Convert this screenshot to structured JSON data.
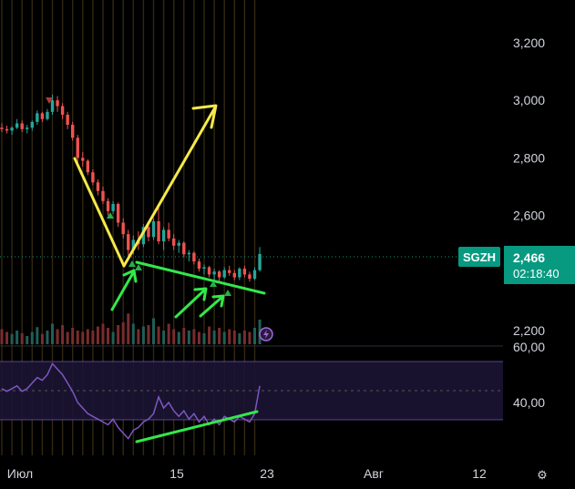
{
  "ticker": "SGZH",
  "last_price": "2,466",
  "countdown": "02:18:40",
  "colors": {
    "up": "#26a69a",
    "down": "#ef5350",
    "rsi": "#7e57c2",
    "annot_yellow": "#f5e94a",
    "annot_green": "#33e84a",
    "accent": "#089981"
  },
  "icons": {
    "settings": "gear-icon",
    "alert": "lightning-icon"
  },
  "chart_data": [
    {
      "type": "candlestick",
      "price_axis_labels": [
        "3,200",
        "3,000",
        "2,800",
        "2,600",
        "2,200"
      ],
      "ylim": [
        2140,
        3360
      ],
      "date_axis_labels": [
        "Июл",
        "15",
        "23",
        "Авг",
        "12"
      ],
      "current_price": 2466,
      "candles": [
        {
          "o": 2905,
          "h": 2920,
          "l": 2890,
          "c": 2900
        },
        {
          "o": 2900,
          "h": 2912,
          "l": 2885,
          "c": 2895
        },
        {
          "o": 2895,
          "h": 2910,
          "l": 2880,
          "c": 2905
        },
        {
          "o": 2905,
          "h": 2935,
          "l": 2900,
          "c": 2920
        },
        {
          "o": 2920,
          "h": 2930,
          "l": 2890,
          "c": 2900
        },
        {
          "o": 2900,
          "h": 2915,
          "l": 2885,
          "c": 2905
        },
        {
          "o": 2905,
          "h": 2930,
          "l": 2895,
          "c": 2925
        },
        {
          "o": 2925,
          "h": 2965,
          "l": 2915,
          "c": 2955
        },
        {
          "o": 2955,
          "h": 2960,
          "l": 2925,
          "c": 2935
        },
        {
          "o": 2935,
          "h": 2970,
          "l": 2930,
          "c": 2960
        },
        {
          "o": 2960,
          "h": 3020,
          "l": 2950,
          "c": 3000
        },
        {
          "o": 3000,
          "h": 3015,
          "l": 2960,
          "c": 2980
        },
        {
          "o": 2980,
          "h": 2990,
          "l": 2935,
          "c": 2950
        },
        {
          "o": 2950,
          "h": 2960,
          "l": 2900,
          "c": 2915
        },
        {
          "o": 2915,
          "h": 2925,
          "l": 2860,
          "c": 2870
        },
        {
          "o": 2870,
          "h": 2880,
          "l": 2780,
          "c": 2800
        },
        {
          "o": 2800,
          "h": 2820,
          "l": 2770,
          "c": 2790
        },
        {
          "o": 2790,
          "h": 2795,
          "l": 2740,
          "c": 2750
        },
        {
          "o": 2750,
          "h": 2760,
          "l": 2705,
          "c": 2715
        },
        {
          "o": 2715,
          "h": 2725,
          "l": 2670,
          "c": 2685
        },
        {
          "o": 2685,
          "h": 2700,
          "l": 2640,
          "c": 2650
        },
        {
          "o": 2650,
          "h": 2660,
          "l": 2600,
          "c": 2615
        },
        {
          "o": 2615,
          "h": 2650,
          "l": 2605,
          "c": 2640
        },
        {
          "o": 2640,
          "h": 2645,
          "l": 2560,
          "c": 2575
        },
        {
          "o": 2575,
          "h": 2590,
          "l": 2520,
          "c": 2535
        },
        {
          "o": 2535,
          "h": 2550,
          "l": 2460,
          "c": 2480
        },
        {
          "o": 2480,
          "h": 2530,
          "l": 2465,
          "c": 2515
        },
        {
          "o": 2515,
          "h": 2545,
          "l": 2480,
          "c": 2500
        },
        {
          "o": 2500,
          "h": 2570,
          "l": 2490,
          "c": 2560
        },
        {
          "o": 2560,
          "h": 2580,
          "l": 2510,
          "c": 2525
        },
        {
          "o": 2525,
          "h": 2590,
          "l": 2515,
          "c": 2580
        },
        {
          "o": 2580,
          "h": 2640,
          "l": 2500,
          "c": 2510
        },
        {
          "o": 2510,
          "h": 2560,
          "l": 2480,
          "c": 2550
        },
        {
          "o": 2550,
          "h": 2575,
          "l": 2510,
          "c": 2520
        },
        {
          "o": 2520,
          "h": 2535,
          "l": 2480,
          "c": 2495
        },
        {
          "o": 2495,
          "h": 2515,
          "l": 2470,
          "c": 2505
        },
        {
          "o": 2505,
          "h": 2510,
          "l": 2455,
          "c": 2465
        },
        {
          "o": 2465,
          "h": 2480,
          "l": 2440,
          "c": 2470
        },
        {
          "o": 2470,
          "h": 2475,
          "l": 2430,
          "c": 2440
        },
        {
          "o": 2440,
          "h": 2450,
          "l": 2405,
          "c": 2415
        },
        {
          "o": 2415,
          "h": 2430,
          "l": 2395,
          "c": 2420
        },
        {
          "o": 2420,
          "h": 2425,
          "l": 2385,
          "c": 2395
        },
        {
          "o": 2395,
          "h": 2415,
          "l": 2375,
          "c": 2405
        },
        {
          "o": 2405,
          "h": 2410,
          "l": 2365,
          "c": 2385
        },
        {
          "o": 2385,
          "h": 2420,
          "l": 2380,
          "c": 2410
        },
        {
          "o": 2410,
          "h": 2425,
          "l": 2390,
          "c": 2400
        },
        {
          "o": 2400,
          "h": 2410,
          "l": 2375,
          "c": 2385
        },
        {
          "o": 2385,
          "h": 2420,
          "l": 2375,
          "c": 2415
        },
        {
          "o": 2415,
          "h": 2425,
          "l": 2385,
          "c": 2395
        },
        {
          "o": 2395,
          "h": 2405,
          "l": 2370,
          "c": 2380
        },
        {
          "o": 2380,
          "h": 2420,
          "l": 2375,
          "c": 2410
        },
        {
          "o": 2410,
          "h": 2490,
          "l": 2405,
          "c": 2466
        }
      ],
      "volume": [
        22,
        18,
        15,
        20,
        16,
        12,
        18,
        25,
        15,
        20,
        30,
        22,
        28,
        18,
        24,
        20,
        18,
        22,
        20,
        26,
        30,
        24,
        18,
        28,
        32,
        45,
        30,
        22,
        26,
        28,
        38,
        26,
        20,
        30,
        22,
        18,
        24,
        20,
        22,
        18,
        16,
        26,
        20,
        24,
        18,
        22,
        20,
        16,
        20,
        18,
        24,
        36
      ],
      "rsi": {
        "axis_labels": [
          "60,00",
          "40,00"
        ],
        "ylim": [
          22,
          68
        ],
        "values": [
          45,
          44,
          45,
          46,
          44,
          45,
          47,
          49,
          48,
          50,
          54,
          52,
          50,
          47,
          44,
          40,
          38,
          36,
          35,
          34,
          33,
          32,
          34,
          31,
          29,
          27,
          30,
          31,
          33,
          34,
          36,
          42,
          38,
          40,
          37,
          35,
          37,
          34,
          36,
          33,
          35,
          32,
          34,
          32,
          35,
          34,
          33,
          35,
          34,
          33,
          36,
          46
        ]
      },
      "annotations": {
        "yellow_lines": 2,
        "green_trendlines": 2,
        "green_arrows": 4,
        "triangle_markers": 5
      }
    }
  ]
}
